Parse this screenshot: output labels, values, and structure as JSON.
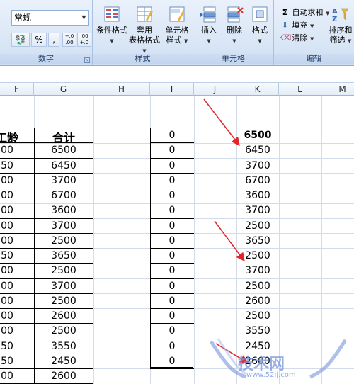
{
  "ribbon": {
    "number_group": {
      "format_value": "常规",
      "percent": "%",
      "comma": ",",
      "increase_decimal": "+.0 .00",
      "decrease_decimal": ".00 +.0",
      "label": "数字"
    },
    "styles_group": {
      "conditional_format": "条件格式",
      "table_format_line1": "套用",
      "table_format_line2": "表格格式",
      "cell_styles_line1": "单元格",
      "cell_styles_line2": "样式",
      "label": "样式"
    },
    "cells_group": {
      "insert": "插入",
      "delete": "删除",
      "format": "格式",
      "label": "单元格"
    },
    "editing_group": {
      "autosum": "自动求和",
      "fill": "填充",
      "clear": "清除",
      "sort_line1": "排序和",
      "sort_line2": "筛选",
      "label": "编辑"
    }
  },
  "columns": [
    "F",
    "G",
    "H",
    "I",
    "J",
    "K",
    "L",
    "M"
  ],
  "sheet": {
    "col_f_header": "工龄",
    "col_g_header": "合计",
    "col_f_values": [
      "00",
      "50",
      "00",
      "00",
      "00",
      "00",
      "00",
      "50",
      "00",
      "00",
      "00",
      "00",
      "00",
      "50",
      "50",
      "00"
    ],
    "col_g_values": [
      "6500",
      "6450",
      "3700",
      "6700",
      "3600",
      "3700",
      "2500",
      "3650",
      "2500",
      "3700",
      "2500",
      "2600",
      "2500",
      "3550",
      "2450",
      "2600"
    ],
    "col_i_values": [
      "0",
      "0",
      "0",
      "0",
      "0",
      "0",
      "0",
      "0",
      "0",
      "0",
      "0",
      "0",
      "0",
      "0",
      "0",
      "0"
    ],
    "col_k_values": [
      "6500",
      "6450",
      "3700",
      "6700",
      "3600",
      "3700",
      "2500",
      "3650",
      "2500",
      "3700",
      "2500",
      "2600",
      "2500",
      "3550",
      "2450",
      "2600"
    ]
  },
  "watermark": {
    "text": "技术网",
    "url": "www.52ij.com"
  },
  "colors": {
    "arrow": "#e0252b",
    "ribbon_bg": "#dbe7f6",
    "grid_line": "#d4dceb"
  }
}
